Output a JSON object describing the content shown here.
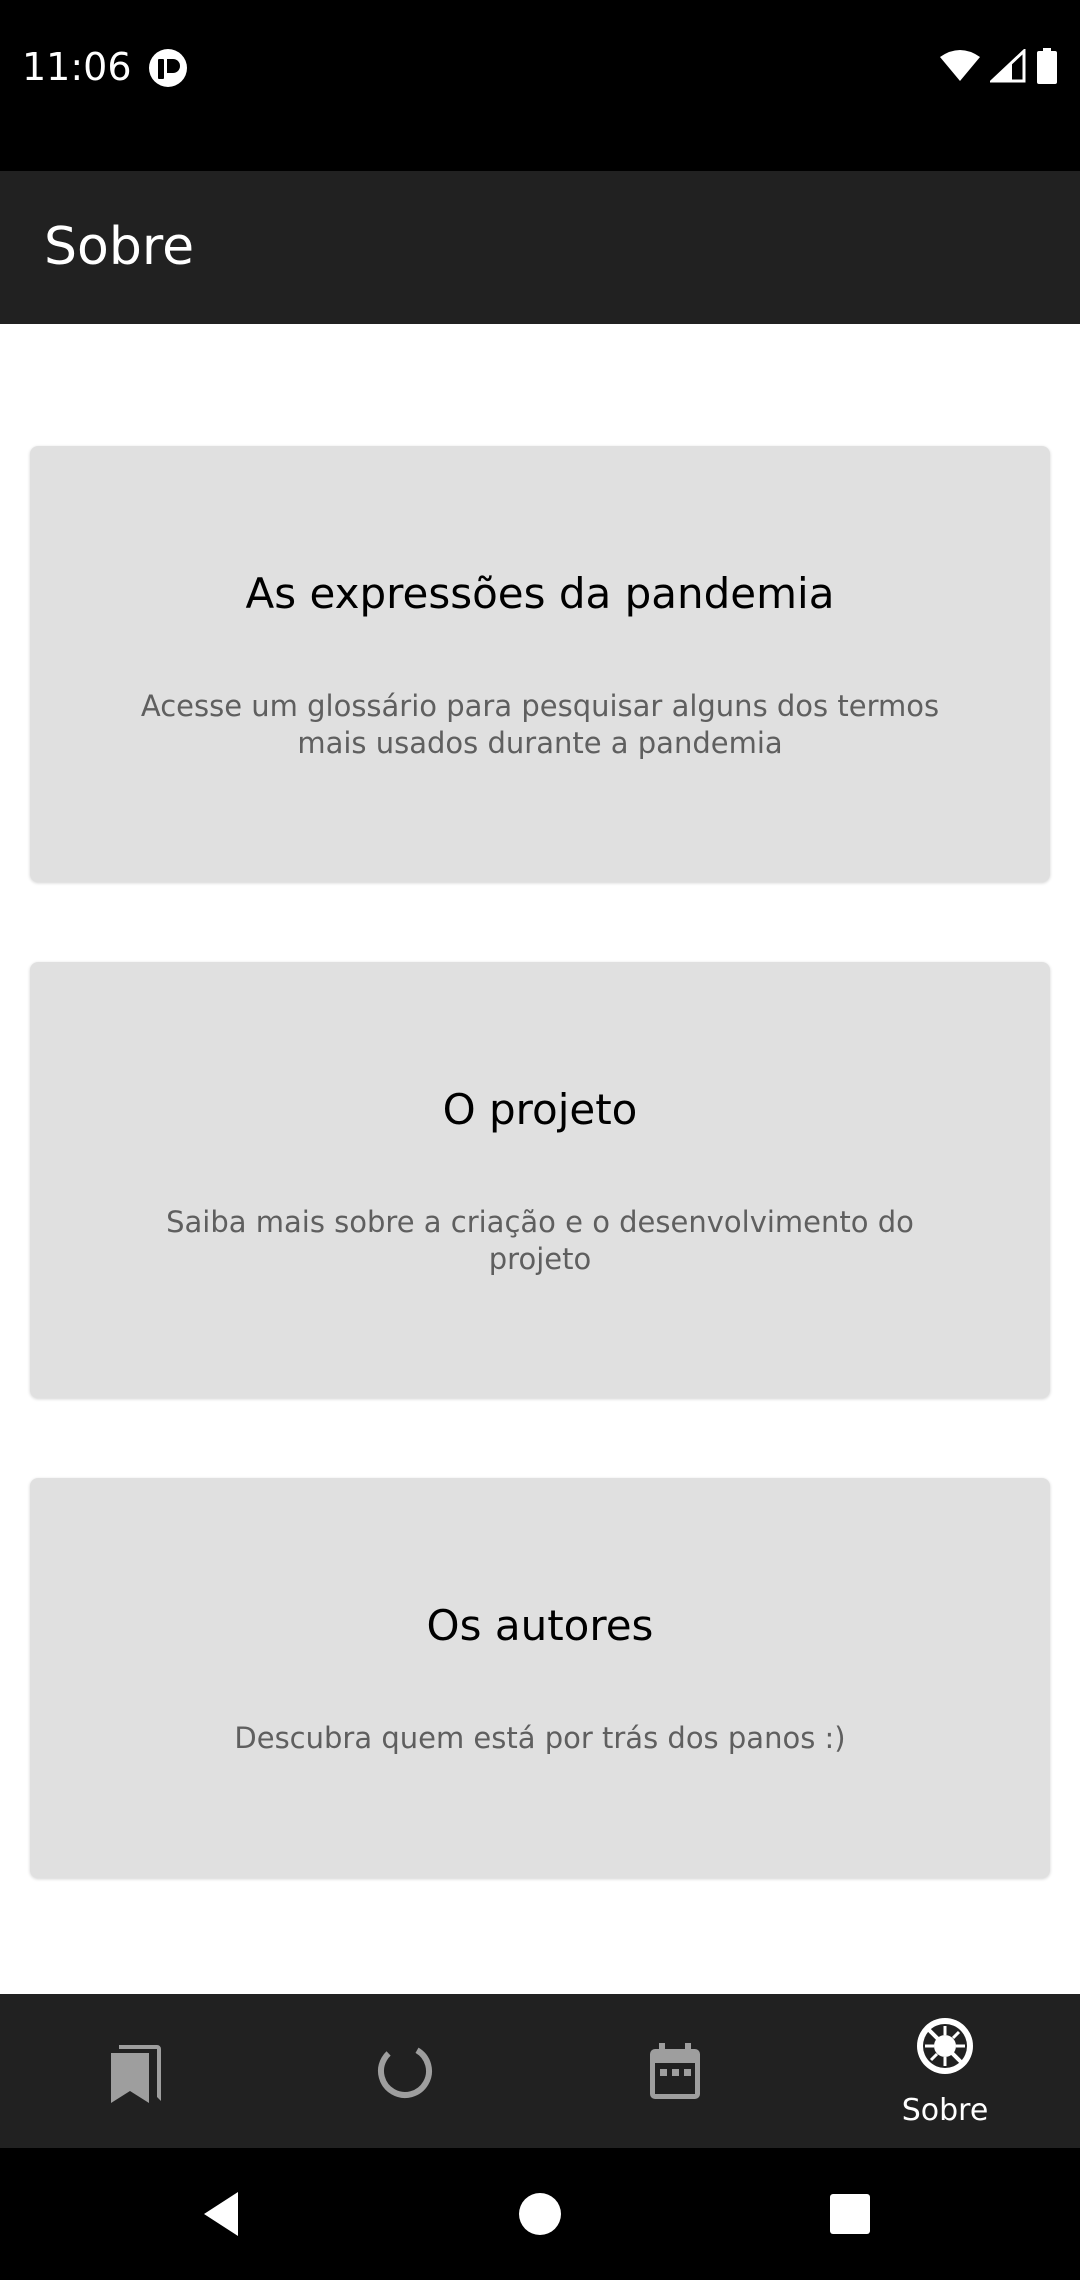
{
  "status_bar": {
    "time": "11:06",
    "app_icon": "app-notification-icon",
    "icons": [
      "wifi-icon",
      "cell-signal-icon",
      "battery-icon"
    ]
  },
  "app_bar": {
    "title": "Sobre"
  },
  "cards": [
    {
      "title": "As expressões da pandemia",
      "description": "Acesse um glossário para pesquisar alguns dos termos mais usados durante a pandemia"
    },
    {
      "title": "O projeto",
      "description": "Saiba mais sobre a criação e o desenvolvimento do projeto"
    },
    {
      "title": "Os autores",
      "description": "Descubra quem está por trás dos panos :)"
    }
  ],
  "bottom_nav": {
    "items": [
      {
        "icon": "bookmarks-icon",
        "label": "",
        "active": false
      },
      {
        "icon": "loading-circle-icon",
        "label": "",
        "active": false
      },
      {
        "icon": "calendar-icon",
        "label": "",
        "active": false
      },
      {
        "icon": "virus-icon",
        "label": "Sobre",
        "active": true
      }
    ]
  },
  "system_nav": {
    "buttons": [
      "back-icon",
      "home-icon",
      "recents-icon"
    ]
  },
  "colors": {
    "app_bar": "#212121",
    "card_background": "#e0e0e0",
    "card_description": "#5f5f5f",
    "bottom_nav": "#212121",
    "inactive_icon": "#9e9e9e",
    "active": "#ffffff"
  }
}
